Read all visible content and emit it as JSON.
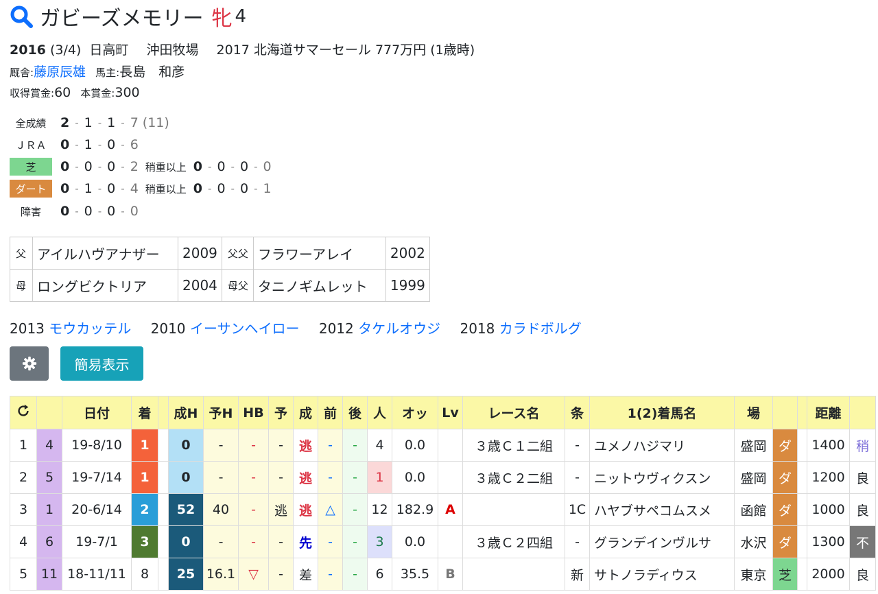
{
  "horse": {
    "name": "ガビーズメモリー",
    "sex": "牝",
    "age": "4",
    "birth_year": "2016",
    "birth_date": "(3/4)",
    "birthplace": "日高町",
    "breeder": "沖田牧場",
    "sale": "2017 北海道サマーセール 777万円 (1歳時)",
    "trainer_label": "厩舎:",
    "trainer": "藤原辰雄",
    "owner_label": "馬主:",
    "owner": "長島　和彦",
    "earned_label": "収得賞金:",
    "earned": "60",
    "prize_label": "本賞金:",
    "prize": "300"
  },
  "stats": {
    "rows": [
      {
        "label": "全成績",
        "nums": [
          "2",
          "1",
          "1",
          "7"
        ],
        "extra": "(11)"
      },
      {
        "label": "ＪＲＡ",
        "nums": [
          "0",
          "1",
          "0",
          "6"
        ],
        "extra": ""
      },
      {
        "label": "芝",
        "nums": [
          "0",
          "0",
          "0",
          "2"
        ],
        "heavy_label": "稍重以上",
        "heavy": [
          "0",
          "0",
          "0",
          "0"
        ]
      },
      {
        "label": "ダート",
        "nums": [
          "0",
          "1",
          "0",
          "4"
        ],
        "heavy_label": "稍重以上",
        "heavy": [
          "0",
          "0",
          "0",
          "1"
        ]
      },
      {
        "label": "障害",
        "nums": [
          "0",
          "0",
          "0",
          "0"
        ]
      }
    ]
  },
  "pedigree": {
    "sire_label": "父",
    "sire": "アイルハヴアナザー",
    "sire_year": "2009",
    "sire_sire_label": "父父",
    "sire_sire": "フラワーアレイ",
    "sire_sire_year": "2002",
    "dam_label": "母",
    "dam": "ロングビクトリア",
    "dam_year": "2004",
    "dam_sire_label": "母父",
    "dam_sire": "タニノギムレット",
    "dam_sire_year": "1999"
  },
  "siblings": [
    {
      "year": "2013",
      "name": "モウカッテル"
    },
    {
      "year": "2010",
      "name": "イーサンヘイロー"
    },
    {
      "year": "2012",
      "name": "タケルオウジ"
    },
    {
      "year": "2018",
      "name": "カラドボルグ"
    }
  ],
  "buttons": {
    "simple": "簡易表示"
  },
  "table": {
    "headers": [
      "",
      "",
      "日付",
      "着",
      "",
      "成H",
      "予H",
      "HB",
      "予",
      "成",
      "前",
      "後",
      "人",
      "オッ",
      "Lv",
      "レース名",
      "条",
      "1(2)着馬名",
      "場",
      "",
      "",
      "距離",
      ""
    ],
    "rows": [
      [
        "1",
        "4",
        "19-8/10",
        "1",
        "",
        "0",
        "-",
        "-",
        "-",
        "逃",
        "-",
        "-",
        "4",
        "0.0",
        "",
        "３歳Ｃ１二組",
        "-",
        "ユメノハジマリ",
        "盛岡",
        "ダ",
        "",
        "1400",
        "稍"
      ],
      [
        "2",
        "5",
        "19-7/14",
        "1",
        "",
        "0",
        "-",
        "-",
        "-",
        "逃",
        "-",
        "-",
        "1",
        "0.0",
        "",
        "３歳Ｃ２二組",
        "-",
        "ニットウヴィクスン",
        "盛岡",
        "ダ",
        "",
        "1200",
        "良"
      ],
      [
        "3",
        "1",
        "20-6/14",
        "2",
        "",
        "52",
        "40",
        "-",
        "逃",
        "逃",
        "△",
        "-",
        "12",
        "182.9",
        "A",
        "",
        "1C",
        "ハヤブサペコムスメ",
        "函館",
        "ダ",
        "",
        "1000",
        "良"
      ],
      [
        "4",
        "6",
        "19-7/1",
        "3",
        "",
        "0",
        "-",
        "-",
        "-",
        "先",
        "-",
        "-",
        "3",
        "0.0",
        "",
        "３歳Ｃ２四組",
        "-",
        "グランデインヴルサ",
        "水沢",
        "ダ",
        "",
        "1300",
        "不"
      ],
      [
        "5",
        "11",
        "18-11/11",
        "8",
        "",
        "25",
        "16.1",
        "▽",
        "-",
        "差",
        "-",
        "-",
        "6",
        "35.5",
        "B",
        "",
        "新",
        "サトノラディウス",
        "東京",
        "芝",
        "",
        "2000",
        "良"
      ]
    ]
  },
  "colors": {
    "accent": "#0d6efd",
    "turf": "#7dd690",
    "dirt": "#d98a3f",
    "header": "#fbf8a6"
  }
}
